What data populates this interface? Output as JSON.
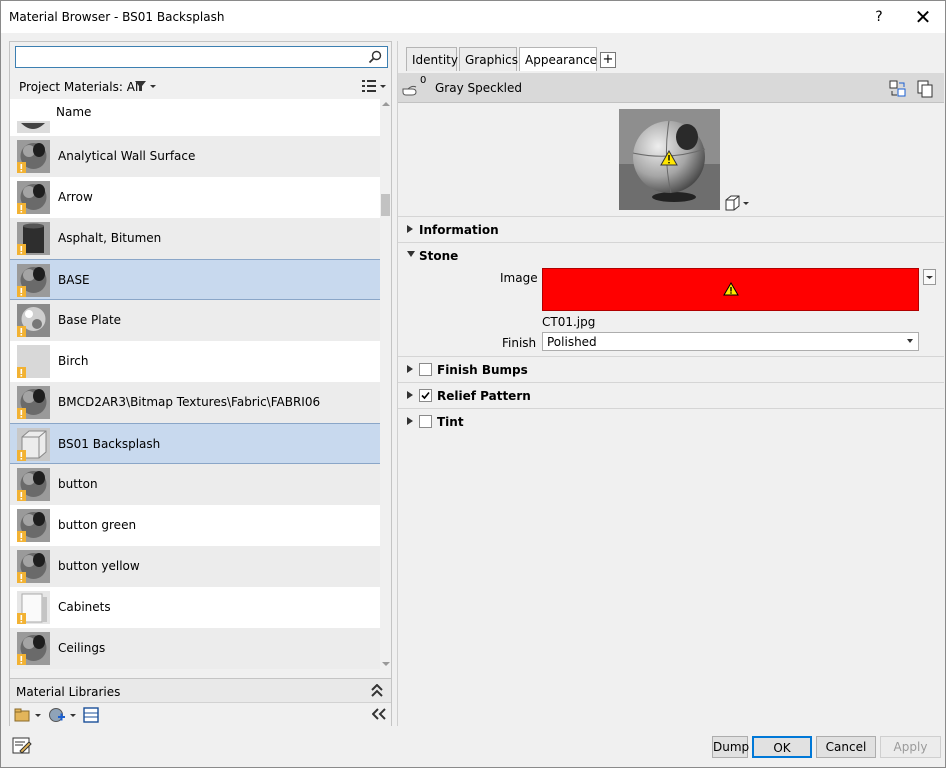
{
  "window": {
    "title": "Material Browser - BS01 Backsplash",
    "help_label": "?",
    "close_label": "✕"
  },
  "left": {
    "search": {
      "value": "",
      "placeholder": ""
    },
    "filter_label": "Project Materials: All",
    "list_header": "Name",
    "items": [
      {
        "label": "Analytical Wall Surface",
        "thumb": "sphere"
      },
      {
        "label": "Arrow",
        "thumb": "sphere"
      },
      {
        "label": "Asphalt, Bitumen",
        "thumb": "cylinder"
      },
      {
        "label": "BASE",
        "thumb": "sphere"
      },
      {
        "label": "Base Plate",
        "thumb": "sphere-metal"
      },
      {
        "label": "Birch",
        "thumb": "flat"
      },
      {
        "label": "BMCD2AR3\\Bitmap Textures\\Fabric\\FABRI06",
        "thumb": "sphere"
      },
      {
        "label": "BS01 Backsplash",
        "thumb": "cube"
      },
      {
        "label": "button",
        "thumb": "sphere"
      },
      {
        "label": "button green",
        "thumb": "sphere"
      },
      {
        "label": "button yellow",
        "thumb": "sphere"
      },
      {
        "label": "Cabinets",
        "thumb": "cabinet"
      },
      {
        "label": "Ceilings",
        "thumb": "sphere"
      }
    ],
    "libraries_label": "Material Libraries"
  },
  "right": {
    "tabs": [
      "Identity",
      "Graphics",
      "Appearance"
    ],
    "add_tab_label": "+",
    "asset_count": "0",
    "asset_name": "Gray Speckled",
    "sections": {
      "information": "Information",
      "stone": "Stone",
      "finish_bumps": "Finish Bumps",
      "relief_pattern": "Relief Pattern",
      "tint": "Tint"
    },
    "stone": {
      "image_label": "Image",
      "image_filename": "CT01.jpg",
      "finish_label": "Finish",
      "finish_value": "Polished"
    },
    "colors": {
      "missing_image": "#ff0000",
      "selection": "#c8d9ee"
    }
  },
  "buttons": {
    "dump": "Dump",
    "ok": "OK",
    "cancel": "Cancel",
    "apply": "Apply"
  }
}
